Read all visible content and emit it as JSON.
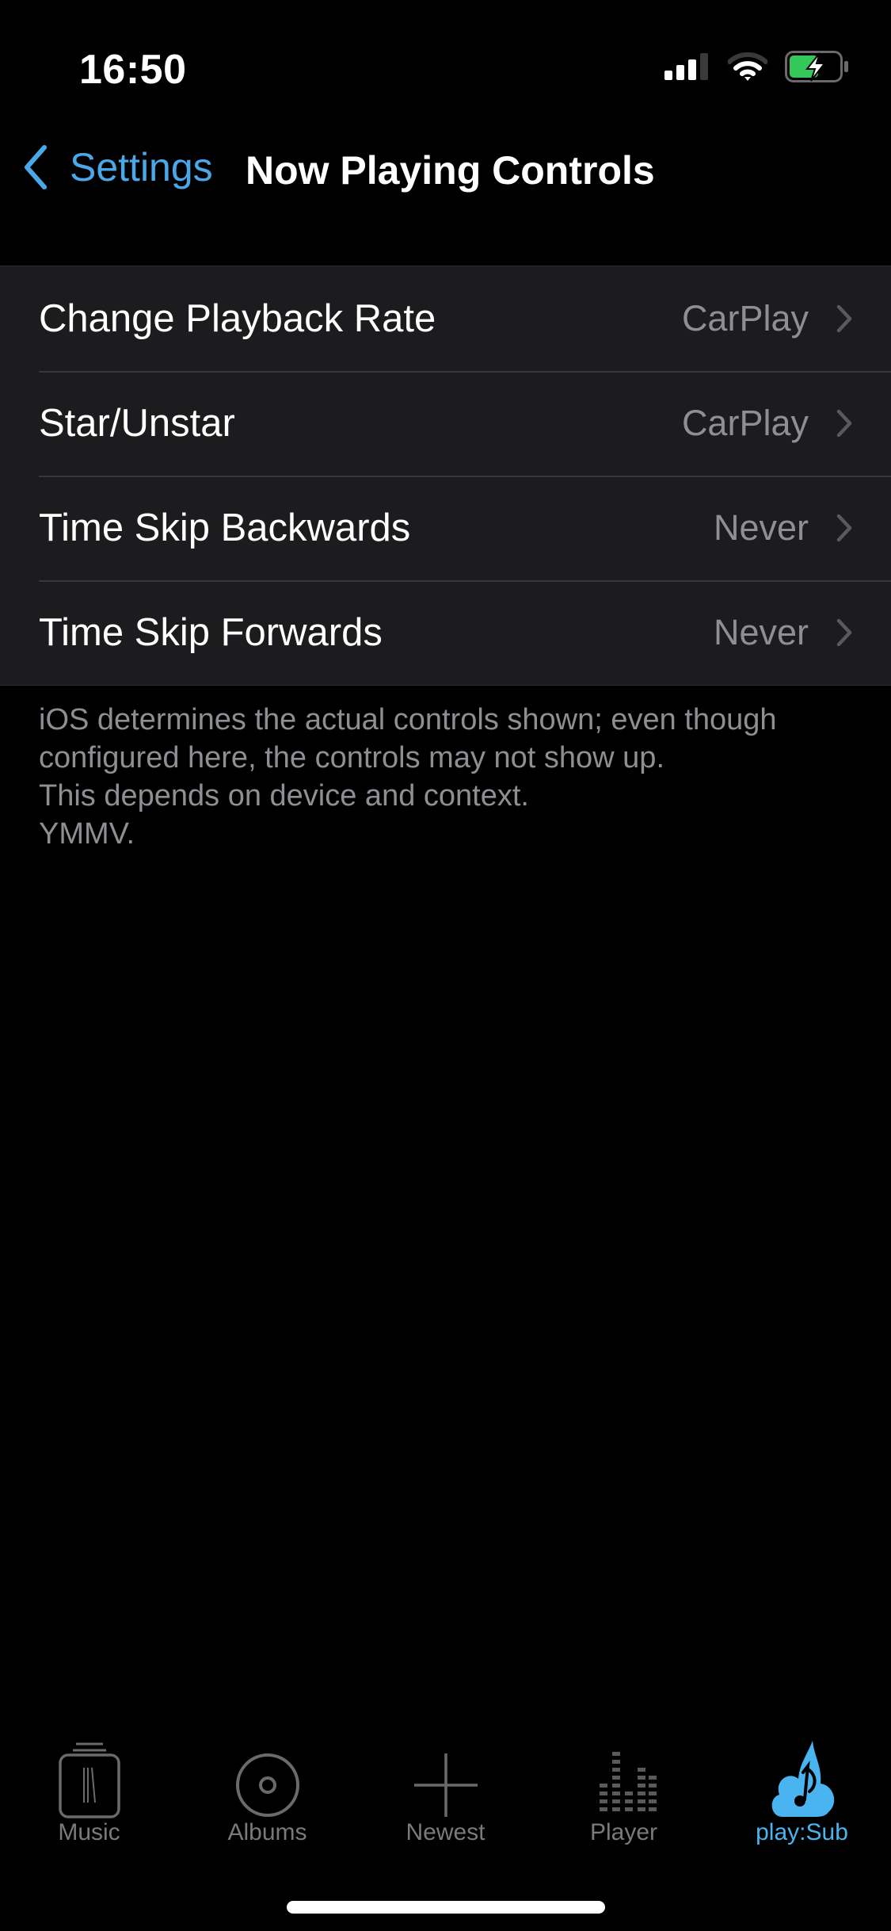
{
  "status_bar": {
    "time": "16:50",
    "icons": [
      "cellular-signal-icon",
      "wifi-icon",
      "battery-charging-icon"
    ],
    "battery_color": "#34c759"
  },
  "nav": {
    "back_label": "Settings",
    "title": "Now Playing Controls",
    "accent_color": "#4aa8e8"
  },
  "settings": {
    "rows": [
      {
        "label": "Change Playback Rate",
        "value": "CarPlay"
      },
      {
        "label": "Star/Unstar",
        "value": "CarPlay"
      },
      {
        "label": "Time Skip Backwards",
        "value": "Never"
      },
      {
        "label": "Time Skip Forwards",
        "value": "Never"
      }
    ],
    "footer_lines": [
      "iOS determines the actual controls shown; even though",
      "configured here, the controls may not show up.",
      "This depends on device and context.",
      "YMMV."
    ]
  },
  "tabbar": {
    "tabs": [
      {
        "label": "Music",
        "icon": "music-jar-icon",
        "active": false
      },
      {
        "label": "Albums",
        "icon": "disc-icon",
        "active": false
      },
      {
        "label": "Newest",
        "icon": "plus-icon",
        "active": false
      },
      {
        "label": "Player",
        "icon": "equalizer-icon",
        "active": false
      },
      {
        "label": "play:Sub",
        "icon": "playsub-cloud-note-icon",
        "active": true
      }
    ],
    "active_color": "#4ab4f0",
    "inactive_color": "#7a7a7a"
  }
}
